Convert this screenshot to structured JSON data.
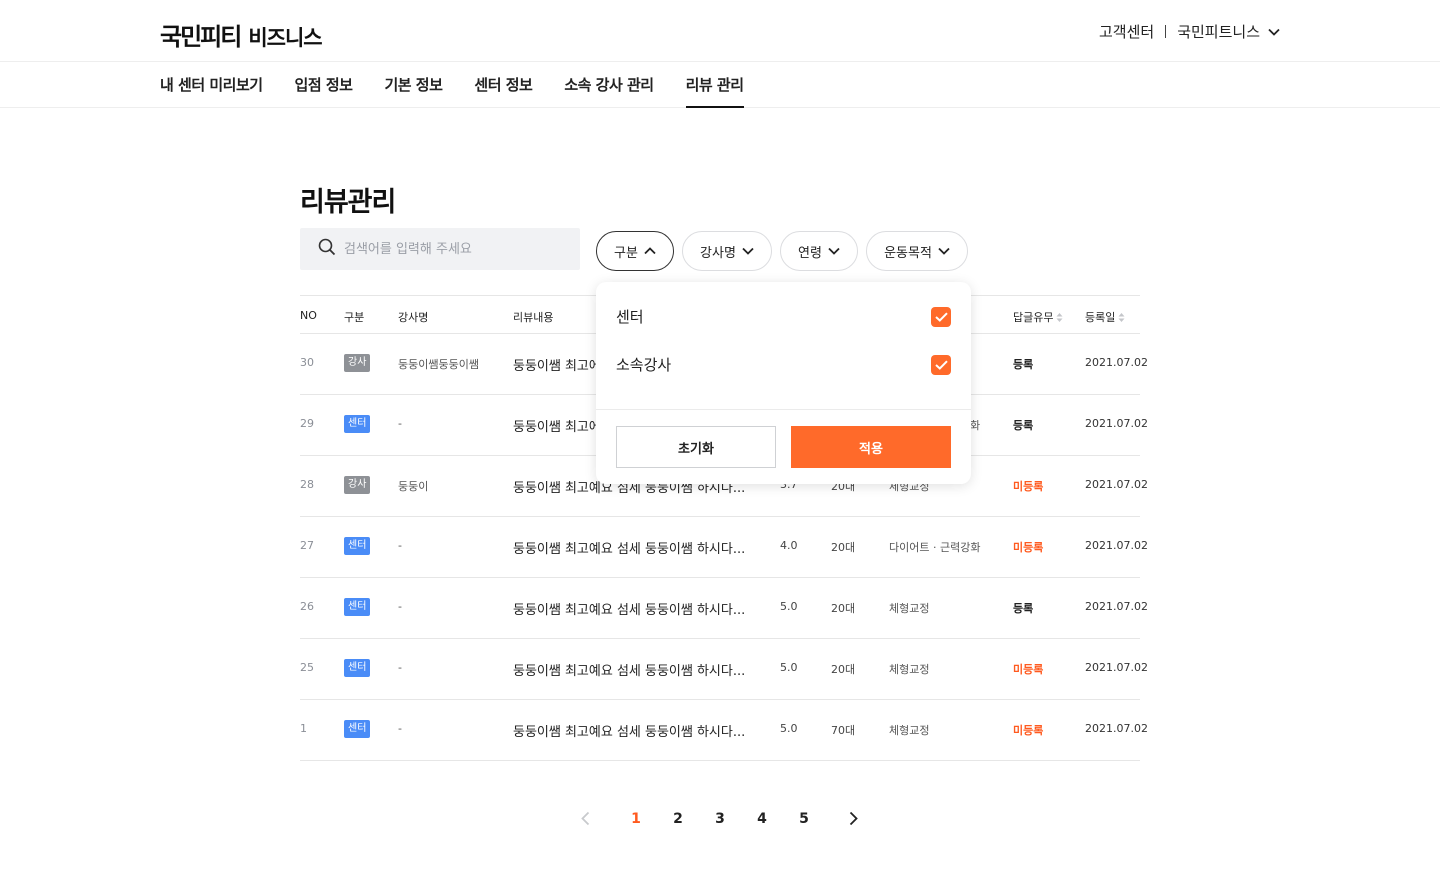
{
  "header": {
    "logo_main": "국민피티",
    "logo_sub": "비즈니스",
    "support": "고객센터",
    "account": "국민피트니스"
  },
  "nav": {
    "items": [
      {
        "label": "내 센터 미리보기"
      },
      {
        "label": "입점 정보"
      },
      {
        "label": "기본 정보"
      },
      {
        "label": "센터 정보"
      },
      {
        "label": "소속 강사 관리"
      },
      {
        "label": "리뷰 관리",
        "active": true
      }
    ]
  },
  "main": {
    "title": "리뷰관리",
    "search_placeholder": "검색어를 입력해 주세요",
    "filters": [
      {
        "label": "구분",
        "open": true
      },
      {
        "label": "강사명"
      },
      {
        "label": "연령"
      },
      {
        "label": "운동목적"
      }
    ]
  },
  "table": {
    "headers": {
      "no": "NO",
      "type": "구분",
      "instructor": "강사명",
      "content": "리뷰내용",
      "reply": "답글유무",
      "date": "등록일"
    },
    "rows": [
      {
        "no": "30",
        "type": "강사",
        "instructor": "둥둥이쌤둥둥이쌤",
        "content": "둥둥이쌤 최고에",
        "score": "",
        "age": "",
        "goal": "",
        "reply": "등록",
        "date": "2021.07.02"
      },
      {
        "no": "29",
        "type": "센터",
        "instructor": "-",
        "content": "둥둥이쌤 최고에",
        "score": "",
        "age": "",
        "goal": "화",
        "reply": "등록",
        "date": "2021.07.02"
      },
      {
        "no": "28",
        "type": "강사",
        "instructor": "둥둥이",
        "content": "둥둥이쌤 최고예요 섬세 둥둥이쌤 하시다...",
        "score": "3.7",
        "age": "20대",
        "goal": "체형교정",
        "reply": "미등록",
        "date": "2021.07.02"
      },
      {
        "no": "27",
        "type": "센터",
        "instructor": "-",
        "content": "둥둥이쌤 최고예요 섬세 둥둥이쌤 하시다...",
        "score": "4.0",
        "age": "20대",
        "goal": "다이어트 · 근력강화",
        "reply": "미등록",
        "date": "2021.07.02"
      },
      {
        "no": "26",
        "type": "센터",
        "instructor": "-",
        "content": "둥둥이쌤 최고예요 섬세 둥둥이쌤 하시다...",
        "score": "5.0",
        "age": "20대",
        "goal": "체형교정",
        "reply": "등록",
        "date": "2021.07.02"
      },
      {
        "no": "25",
        "type": "센터",
        "instructor": "-",
        "content": "둥둥이쌤 최고예요 섬세 둥둥이쌤 하시다...",
        "score": "5.0",
        "age": "20대",
        "goal": "체형교정",
        "reply": "미등록",
        "date": "2021.07.02"
      },
      {
        "no": "1",
        "type": "센터",
        "instructor": "-",
        "content": "둥둥이쌤 최고예요 섬세 둥둥이쌤 하시다...",
        "score": "5.0",
        "age": "70대",
        "goal": "체형교정",
        "reply": "미등록",
        "date": "2021.07.02"
      }
    ]
  },
  "dropdown": {
    "options": [
      {
        "label": "센터",
        "checked": true
      },
      {
        "label": "소속강사",
        "checked": true
      }
    ],
    "reset_label": "초기화",
    "apply_label": "적용"
  },
  "pagination": {
    "pages": [
      "1",
      "2",
      "3",
      "4",
      "5"
    ],
    "current": "1"
  },
  "colors": {
    "accent": "#ff6a2a",
    "badge_instructor": "#8e9196",
    "badge_center": "#4a8cf7",
    "reply_pending": "#ff5a1f"
  },
  "icons": {
    "search": "search-icon",
    "chevron_down": "chevron-down-icon",
    "chevron_up": "chevron-up-icon",
    "sort": "sort-icon",
    "check": "check-icon",
    "prev": "chevron-left-icon",
    "next": "chevron-right-icon"
  }
}
